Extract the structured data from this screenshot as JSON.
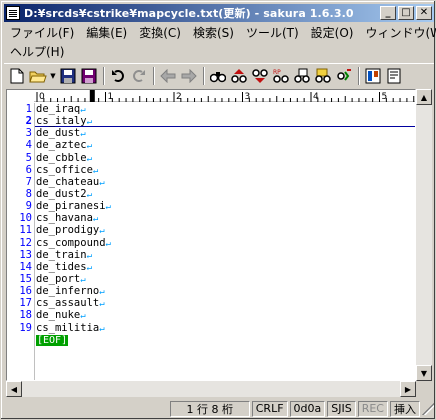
{
  "window": {
    "title": "D:¥srcds¥cstrike¥mapcycle.txt(更新) - sakura 1.6.3.0",
    "buttons": {
      "minimize": "_",
      "maximize": "□",
      "close": "✕"
    }
  },
  "menu": {
    "row1": [
      "ファイル(F)",
      "編集(E)",
      "変換(C)",
      "検索(S)",
      "ツール(T)",
      "設定(O)",
      "ウィンドウ(W)"
    ],
    "row2": [
      "ヘルプ(H)"
    ]
  },
  "toolbar": {
    "icons": [
      "new-file-icon",
      "open-folder-icon",
      "dropdown-icon",
      "save-icon",
      "save-all-icon",
      "undo-icon",
      "redo-icon",
      "jump-back-icon",
      "jump-forward-icon",
      "find-icon",
      "find-prev-icon",
      "find-next-icon",
      "replace-icon",
      "grep-icon",
      "bookmark-icon",
      "outline-icon",
      "settings-icon"
    ]
  },
  "ruler": {
    "labels": [
      "0",
      "1",
      "2",
      "3",
      "4",
      "5"
    ]
  },
  "editor": {
    "current_line": 2,
    "lines": [
      {
        "num": "1",
        "text": "de_iraq"
      },
      {
        "num": "2",
        "text": "cs_italy"
      },
      {
        "num": "3",
        "text": "de_dust"
      },
      {
        "num": "4",
        "text": "de_aztec"
      },
      {
        "num": "5",
        "text": "de_cbble"
      },
      {
        "num": "6",
        "text": "cs_office"
      },
      {
        "num": "7",
        "text": "de_chateau"
      },
      {
        "num": "8",
        "text": "de_dust2"
      },
      {
        "num": "9",
        "text": "de_piranesi"
      },
      {
        "num": "10",
        "text": "cs_havana"
      },
      {
        "num": "11",
        "text": "de_prodigy"
      },
      {
        "num": "12",
        "text": "cs_compound"
      },
      {
        "num": "13",
        "text": "de_train"
      },
      {
        "num": "14",
        "text": "de_tides"
      },
      {
        "num": "15",
        "text": "de_port"
      },
      {
        "num": "16",
        "text": "de_inferno"
      },
      {
        "num": "17",
        "text": "cs_assault"
      },
      {
        "num": "18",
        "text": "de_nuke"
      },
      {
        "num": "19",
        "text": "cs_militia"
      }
    ],
    "eol_mark": "↵",
    "eof_mark": "[EOF]"
  },
  "status": {
    "position": "1 行   8 桁",
    "newline": "CRLF",
    "char_code": "0d0a",
    "encoding": "SJIS",
    "rec": "REC",
    "mode": "挿入"
  }
}
